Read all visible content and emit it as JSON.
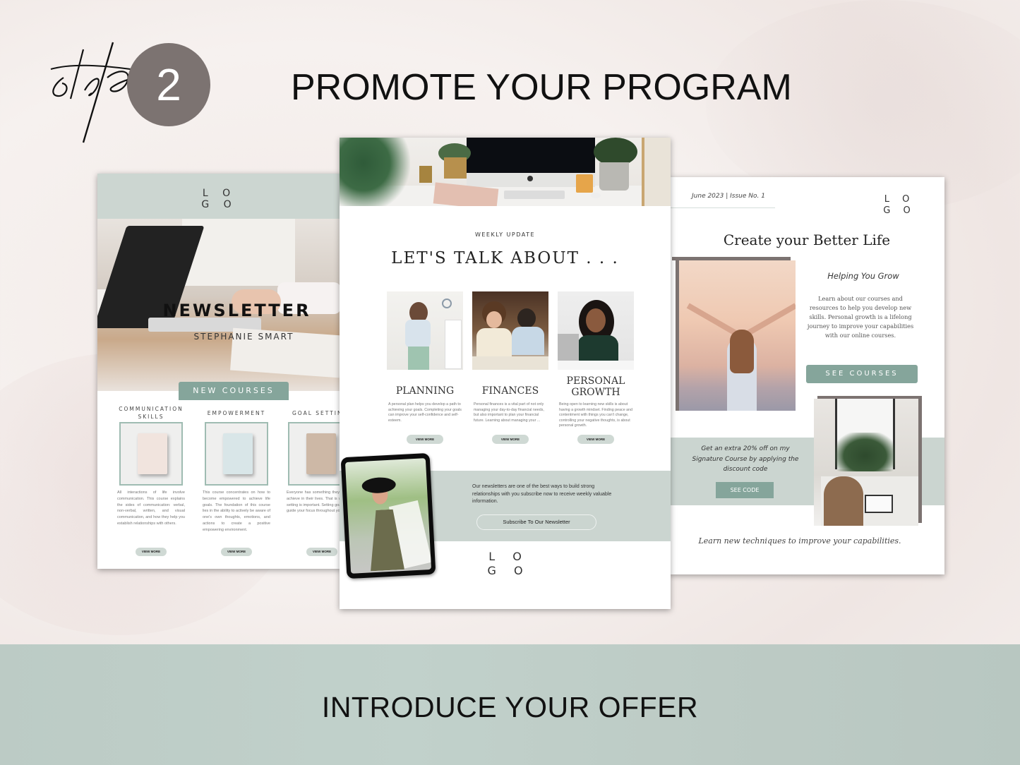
{
  "header": {
    "step_word": "step",
    "step_number": "2",
    "title": "PROMOTE YOUR PROGRAM"
  },
  "colors": {
    "accent_sage": "#85a59b",
    "band_sage": "#cbd5d0",
    "step_circle": "#7c7371",
    "bottom_band": "#bfcec8"
  },
  "left_card": {
    "logo_line1": "L O",
    "logo_line2": "G O",
    "title": "NEWSLETTER",
    "subtitle": "STEPHANIE SMART",
    "section_button": "NEW COURSES",
    "courses": [
      {
        "title": "COMMUNICATION SKILLS",
        "package_color": "#f1e4de",
        "description": "All interactions of life involve communication. This course explains the sides of communication: verbal, non-verbal, written, and visual communication, and how they help you establish relationships with others.",
        "button": "VIEW MORE"
      },
      {
        "title": "EMPOWERMENT",
        "package_color": "#d9e6e8",
        "description": "This course concentrates on how to become empowered to achieve life goals. The foundation of this course lies in the ability to actively be aware of one's own thoughts, emotions, and actions to create a positive empowering environment.",
        "button": "VIEW MORE"
      },
      {
        "title": "GOAL SETTING",
        "package_color": "#cdb8a6",
        "description": "Everyone has something they want to achieve in their lives. That is why goal setting is important. Setting goals helps guide your focus throughout your life.",
        "button": "VIEW MORE"
      }
    ]
  },
  "middle_card": {
    "kicker": "WEEKLY UPDATE",
    "headline": "LET'S TALK ABOUT . . .",
    "topics": [
      {
        "name": "PLANNING",
        "description": "A personal plan helps you develop a path to achieving your goals. Completing your goals can improve your self-confidence and self-esteem.",
        "button": "VIEW MORE"
      },
      {
        "name": "FINANCES",
        "description": "Personal finances is a vital part of not only managing your day-to-day financial needs, but also important to plan your financial future. Learning about managing your ...",
        "button": "VIEW MORE"
      },
      {
        "name": "PERSONAL GROWTH",
        "description": "Being open to learning new skills is about having a growth mindset. Finding peace and contentment with things you can't change, controlling your negative thoughts, is about personal growth.",
        "button": "VIEW MORE"
      }
    ],
    "subscribe_text": "Our newsletters are one of the best ways to build strong relationships with you subscribe now to receive weekly valuable information.",
    "subscribe_button": "Subscribe To Our Newsletter",
    "logo_line1": "L O",
    "logo_line2": "G O"
  },
  "right_card": {
    "issue": "June 2023 | Issue No. 1",
    "logo_line1": "L O",
    "logo_line2": "G O",
    "headline": "Create your Better Life",
    "grow_title": "Helping You Grow",
    "grow_description": "Learn about our courses and resources to help you develop new skills. Personal growth is a lifelong journey to improve your capabilities with our online courses.",
    "see_courses_button": "SEE COURSES",
    "offer_text": "Get an extra 20% off on my Signature Course by applying the discount code",
    "see_code_button": "SEE CODE",
    "closing": "Learn new techniques to improve your capabilities."
  },
  "footer": {
    "title": "INTRODUCE YOUR OFFER"
  }
}
